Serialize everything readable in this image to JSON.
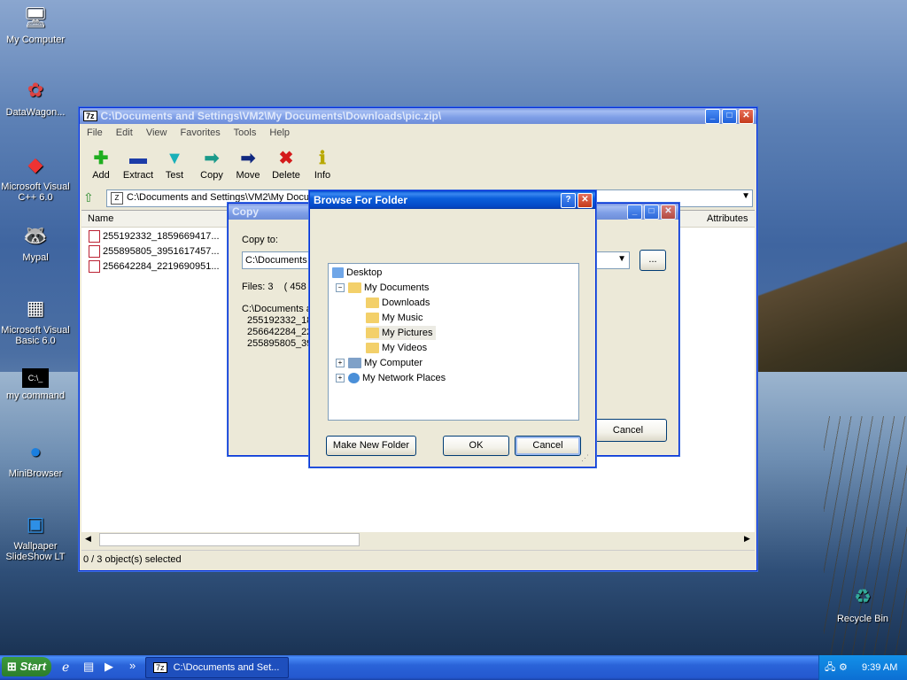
{
  "desktop": {
    "icons": [
      {
        "label": "My Computer"
      },
      {
        "label": "DataWagon..."
      },
      {
        "label": "Microsoft Visual C++ 6.0"
      },
      {
        "label": "Mypal"
      },
      {
        "label": "Microsoft Visual Basic 6.0"
      },
      {
        "label": "my command"
      },
      {
        "label": "MiniBrowser"
      },
      {
        "label": "Wallpaper SlideShow LT"
      },
      {
        "label": "Recycle Bin"
      }
    ]
  },
  "main_window": {
    "title": "C:\\Documents and Settings\\VM2\\My Documents\\Downloads\\pic.zip\\",
    "app_badge": "7z",
    "menu": [
      "File",
      "Edit",
      "View",
      "Favorites",
      "Tools",
      "Help"
    ],
    "toolbar": [
      "Add",
      "Extract",
      "Test",
      "Copy",
      "Move",
      "Delete",
      "Info"
    ],
    "address": "C:\\Documents and Settings\\VM2\\My Docum",
    "columns": {
      "name": "Name",
      "attributes": "Attributes"
    },
    "files": [
      "255192332_1859669417...",
      "255895805_3951617457...",
      "256642284_2219690951..."
    ],
    "status": "0 / 3 object(s) selected"
  },
  "copy_dialog": {
    "title": "Copy",
    "copy_to_label": "Copy to:",
    "path_value": "C:\\Documents a",
    "browse_label": "...",
    "files_info": "Files: 3    ( 458 5",
    "list": [
      "C:\\Documents a",
      "255192332_18",
      "256642284_22",
      "255895805_39"
    ],
    "cancel_label": "Cancel"
  },
  "browse_dialog": {
    "title": "Browse For Folder",
    "help_label": "?",
    "tree": [
      {
        "label": "Desktop"
      },
      {
        "label": "My Documents"
      },
      {
        "label": "Downloads"
      },
      {
        "label": "My Music"
      },
      {
        "label": "My Pictures"
      },
      {
        "label": "My Videos"
      },
      {
        "label": "My Computer"
      },
      {
        "label": "My Network Places"
      }
    ],
    "make_folder_label": "Make New Folder",
    "ok_label": "OK",
    "cancel_label": "Cancel"
  },
  "taskbar": {
    "start_label": "Start",
    "more_label": "»",
    "task_label": "C:\\Documents and Set...",
    "task_badge": "7z",
    "clock": "9:39 AM"
  }
}
